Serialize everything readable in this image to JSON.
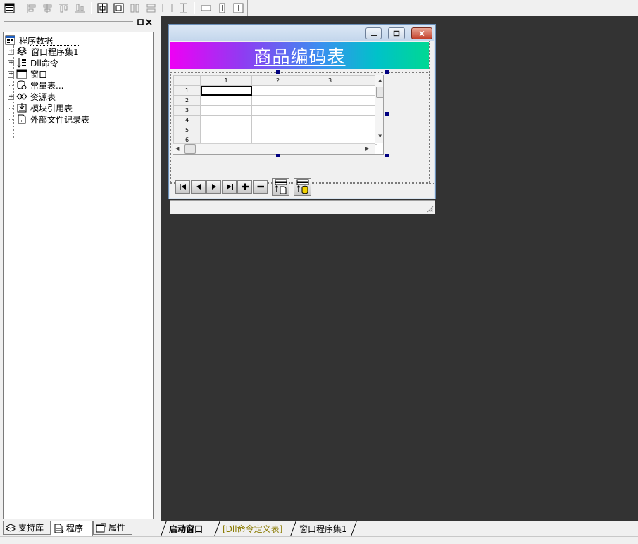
{
  "toolbar": {
    "icons": [
      "form-icon",
      "align-left-icon",
      "align-center-v-icon",
      "align-top-icon",
      "align-bottom-icon",
      "center-h-icon",
      "center-v-icon",
      "space-h-icon",
      "space-v-icon",
      "equal-width-icon",
      "equal-height-icon",
      "size-width-icon",
      "size-height-icon",
      "size-both-icon"
    ]
  },
  "panel": {
    "tree": {
      "root": "程序数据",
      "items": [
        {
          "label": "窗口程序集1",
          "icon": "assembly-icon",
          "expandable": true
        },
        {
          "label": "Dll命令",
          "icon": "dll-icon",
          "expandable": true
        },
        {
          "label": "窗口",
          "icon": "window-icon",
          "expandable": true
        },
        {
          "label": "常量表...",
          "icon": "constants-icon",
          "expandable": false
        },
        {
          "label": "资源表",
          "icon": "resources-icon",
          "expandable": true
        },
        {
          "label": "模块引用表",
          "icon": "module-ref-icon",
          "expandable": false
        },
        {
          "label": "外部文件记录表",
          "icon": "external-file-icon",
          "expandable": false
        }
      ]
    },
    "tabs": [
      {
        "label": "支持库",
        "icon": "library-icon"
      },
      {
        "label": "程序",
        "icon": "program-icon"
      },
      {
        "label": "属性",
        "icon": "properties-icon"
      }
    ]
  },
  "designer": {
    "banner_title": "商品编码表",
    "grid": {
      "columns": [
        "1",
        "2",
        "3"
      ],
      "rows": [
        "1",
        "2",
        "3",
        "4",
        "5",
        "6"
      ]
    }
  },
  "main_tabs": [
    {
      "label": "启动窗口"
    },
    {
      "label": "[Dll命令定义表]"
    },
    {
      "label": "窗口程序集1"
    }
  ]
}
